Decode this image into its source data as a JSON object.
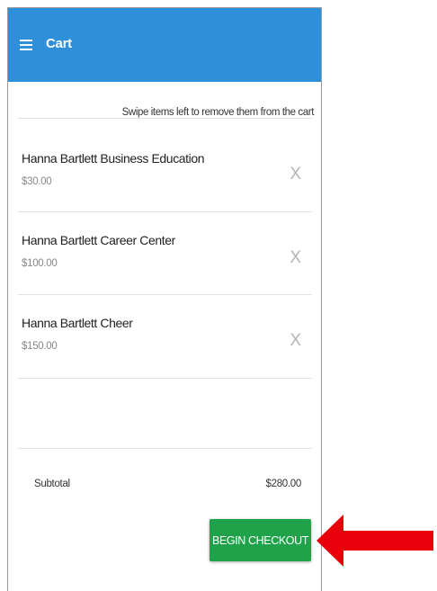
{
  "header": {
    "title": "Cart",
    "menu_icon": "hamburger-menu-icon",
    "background": "#2f8fd8"
  },
  "hint": "Swipe items left to remove them from the cart",
  "items": [
    {
      "name": "Hanna Bartlett Business Education",
      "price": "$30.00",
      "remove": "X"
    },
    {
      "name": "Hanna Bartlett Career Center",
      "price": "$100.00",
      "remove": "X"
    },
    {
      "name": "Hanna Bartlett Cheer",
      "price": "$150.00",
      "remove": "X"
    }
  ],
  "summary": {
    "subtotal_label": "Subtotal",
    "subtotal_value": "$280.00"
  },
  "checkout": {
    "label": "BEGIN CHECKOUT",
    "color": "#20a24a"
  },
  "annotation": {
    "icon": "red-arrow-icon",
    "color": "#e8000b"
  }
}
